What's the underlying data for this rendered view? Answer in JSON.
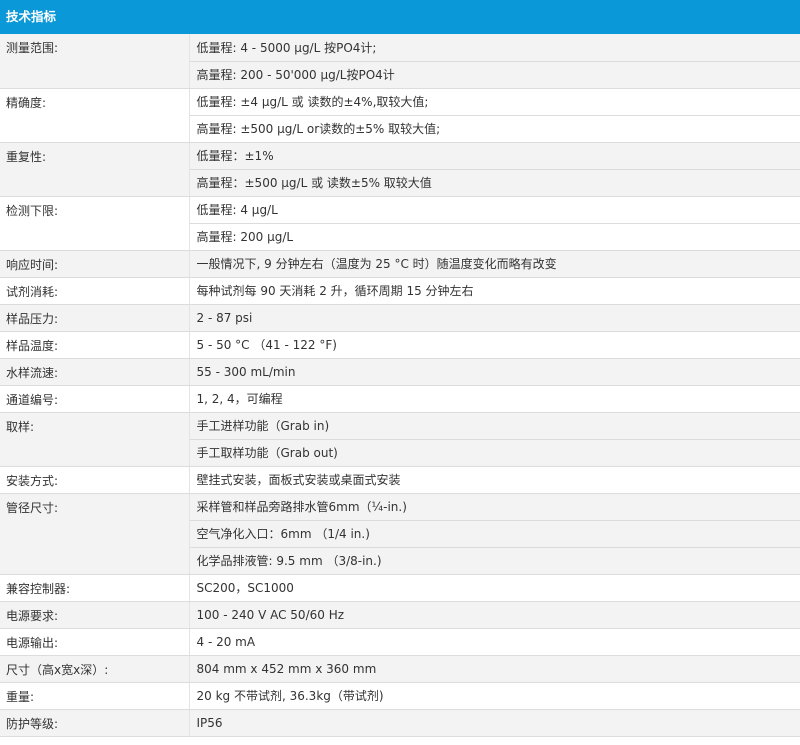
{
  "title": "技术指标",
  "specs": [
    {
      "label": "测量范围:",
      "values": [
        "低量程: 4 - 5000 μg/L 按PO4计;",
        "高量程: 200 - 50'000 μg/L按PO4计"
      ]
    },
    {
      "label": "精确度:",
      "values": [
        "低量程: ±4 μg/L 或 读数的±4%,取较大值;",
        "高量程: ±500 μg/L or读数的±5% 取较大值;"
      ]
    },
    {
      "label": "重复性:",
      "values": [
        "低量程：±1%",
        "高量程：±500 μg/L 或 读数±5% 取较大值"
      ]
    },
    {
      "label": "检测下限:",
      "values": [
        "低量程: 4 μg/L",
        "高量程: 200 μg/L"
      ]
    },
    {
      "label": "响应时间:",
      "values": [
        "一般情况下, 9 分钟左右（温度为 25 °C 时）随温度变化而略有改变"
      ]
    },
    {
      "label": "试剂消耗:",
      "values": [
        "每种试剂每 90 天消耗 2 升，循环周期 15 分钟左右"
      ]
    },
    {
      "label": "样品压力:",
      "values": [
        "2 - 87 psi"
      ]
    },
    {
      "label": "样品温度:",
      "values": [
        "5 - 50 °C （41 - 122 °F)"
      ]
    },
    {
      "label": "水样流速:",
      "values": [
        "55 - 300 mL/min"
      ]
    },
    {
      "label": "通道编号:",
      "values": [
        "1, 2, 4，可编程"
      ]
    },
    {
      "label": "取样:",
      "values": [
        "手工进样功能（Grab in)",
        "手工取样功能（Grab out)"
      ]
    },
    {
      "label": "安装方式:",
      "values": [
        "壁挂式安装，面板式安装或桌面式安装"
      ]
    },
    {
      "label": "管径尺寸:",
      "values": [
        "采样管和样品旁路排水管6mm（¼-in.)",
        "空气净化入口：6mm （1/4 in.)",
        "化学品排液管: 9.5 mm （3/8-in.)"
      ]
    },
    {
      "label": "兼容控制器:",
      "values": [
        "SC200，SC1000"
      ]
    },
    {
      "label": "电源要求:",
      "values": [
        "100 - 240 V AC 50/60 Hz"
      ]
    },
    {
      "label": "电源输出:",
      "values": [
        "4 - 20 mA"
      ]
    },
    {
      "label": "尺寸（高x宽x深）:",
      "values": [
        "804 mm x 452 mm x 360 mm"
      ]
    },
    {
      "label": "重量:",
      "values": [
        "20 kg 不带试剂, 36.3kg（带试剂)"
      ]
    },
    {
      "label": "防护等级:",
      "values": [
        "IP56"
      ]
    }
  ]
}
